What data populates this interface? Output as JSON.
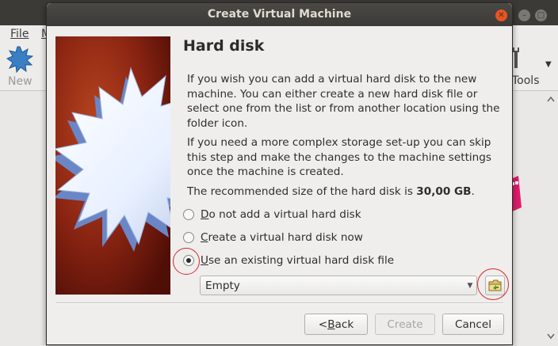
{
  "background_window": {
    "menu": {
      "file": "File",
      "machine": "M"
    },
    "toolbar": {
      "new_label": "New",
      "tools_label": "Tools"
    }
  },
  "dialog": {
    "title": "Create Virtual Machine",
    "heading": "Hard disk",
    "paragraph1": "If you wish you can add a virtual hard disk to the new machine. You can either create a new hard disk file or select one from the list or from another location using the folder icon.",
    "paragraph2": "If you need a more complex storage set-up you can skip this step and make the changes to the machine settings once the machine is created.",
    "recommended_prefix": "The recommended size of the hard disk is ",
    "recommended_size": "30,00 GB",
    "recommended_suffix": ".",
    "options": [
      {
        "accel": "D",
        "rest": "o not add a virtual hard disk",
        "checked": false
      },
      {
        "accel": "C",
        "rest": "reate a virtual hard disk now",
        "checked": false
      },
      {
        "accel": "U",
        "rest": "se an existing virtual hard disk file",
        "checked": true
      }
    ],
    "disk_select": {
      "value": "Empty"
    },
    "buttons": {
      "back_accel": "< ",
      "back_underlined": "B",
      "back_rest": "ack",
      "create": "Create",
      "cancel": "Cancel"
    }
  },
  "colors": {
    "titlebar": "#3b3a36",
    "close_button": "#e95420",
    "annotation": "#d42a2a"
  }
}
